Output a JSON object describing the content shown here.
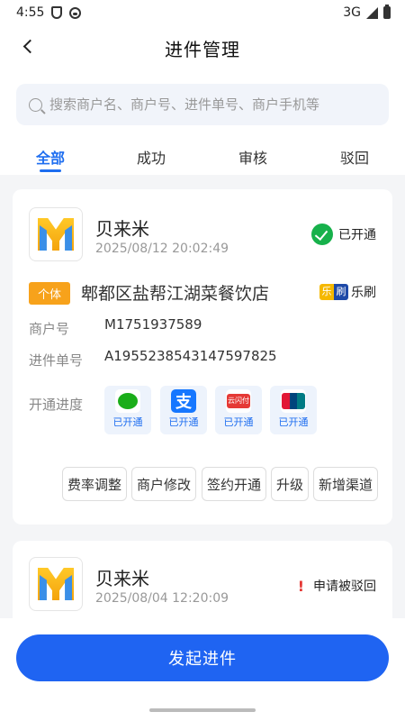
{
  "status_bar": {
    "time": "4:55",
    "network": "3G"
  },
  "nav": {
    "title": "进件管理"
  },
  "search": {
    "placeholder": "搜索商户名、商户号、进件单号、商户手机等"
  },
  "tabs": [
    {
      "label": "全部",
      "active": true
    },
    {
      "label": "成功"
    },
    {
      "label": "审核"
    },
    {
      "label": "驳回"
    }
  ],
  "cards": [
    {
      "merchant_name": "贝来米",
      "time": "2025/08/12 20:02:49",
      "status": "已开通",
      "tag": "个体",
      "shop_name": "郫都区盐帮江湖菜餐饮店",
      "brand": "乐刷",
      "brand_logo_chars": [
        "乐",
        "刷"
      ],
      "merchant_no_label": "商户号",
      "merchant_no": "M1751937589",
      "order_no_label": "进件单号",
      "order_no": "A1955238543147597825",
      "progress_label": "开通进度",
      "channels": [
        {
          "name": "wechat-pay",
          "status": "已开通"
        },
        {
          "name": "alipay",
          "icon_char": "支",
          "status": "已开通"
        },
        {
          "name": "yunshanfu",
          "icon_text": "云闪付",
          "status": "已开通"
        },
        {
          "name": "unionpay",
          "status": "已开通"
        }
      ],
      "actions": [
        "费率调整",
        "商户修改",
        "签约开通",
        "升级",
        "新增渠道"
      ]
    },
    {
      "merchant_name": "贝来米",
      "time": "2025/08/04 12:20:09",
      "status": "申请被驳回"
    }
  ],
  "submit_label": "发起进件",
  "colors": {
    "primary": "#1f64f2",
    "success": "#17b14b",
    "tag": "#f7a21b",
    "reject": "#e53935"
  }
}
